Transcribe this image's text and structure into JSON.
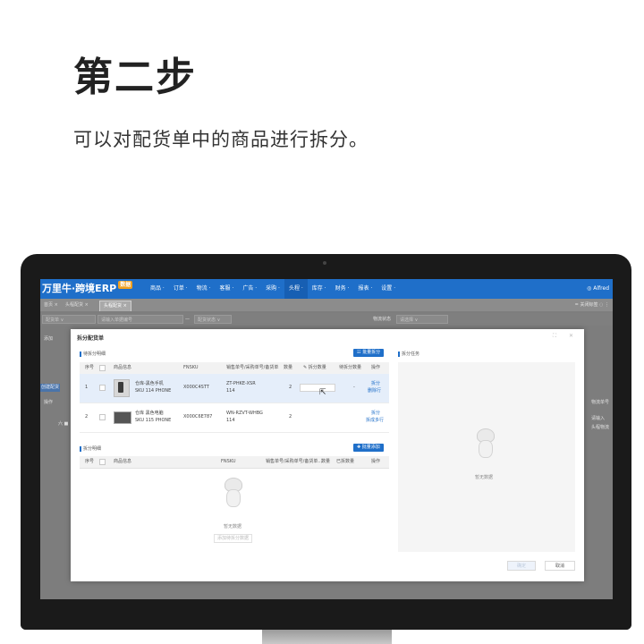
{
  "heading": {
    "title": "第二步",
    "subtitle": "可以对配货单中的商品进行拆分。"
  },
  "app": {
    "brand": "万里牛·跨境ERP",
    "brand_badge": "数据",
    "nav": [
      "商品 ·",
      "订单 ·",
      "物流 ·",
      "客服 ·",
      "广告 ·",
      "采购 ·",
      "头程 ·",
      "库存 ·",
      "财务 ·",
      "报表 ·",
      "设置 ·"
    ],
    "active_nav_index": 6,
    "user": "Alfred",
    "tabs": [
      "首页 ×",
      "头程配货 ×",
      "头程配货 ×"
    ],
    "tab_tools": "= 关闭标签  ◌  ⋮",
    "filters": [
      "配货单 ∨",
      "请输入单据编号",
      "—",
      "配货状态 ∨",
      "物流状态",
      "请选择 ∨"
    ],
    "bg_left": [
      "添加",
      "创建配货",
      "操作",
      "六 ■"
    ],
    "bg_right": [
      "物流单号",
      "请输入",
      "头程物流"
    ]
  },
  "modal": {
    "title": "拆分配货单",
    "controls": "⛶ ✕",
    "source_section": "待拆分明细",
    "batch_split_btn": "☷ 批量拆分",
    "columns": [
      "序号",
      "商品信息",
      "FNSKU",
      "销售单号/采购单号/备货单",
      "数量",
      "✎ 拆分数量",
      "待拆分数量",
      "操作"
    ],
    "rows": [
      {
        "index": "1",
        "name": "仓库-黑色手机",
        "sku": "SKU 114 PHONE",
        "fnsku": "X000C4STT",
        "order": "ZT-PHKE-XSR",
        "order2": "114",
        "qty": "2",
        "remain": "-",
        "op1": "拆分",
        "op2": "删除行"
      },
      {
        "index": "2",
        "name": "仓库 黑色电脑",
        "sku": "SKU 115 PHONE",
        "fnsku": "X000C6E787",
        "order": "WN-RZVT-WHBG",
        "order2": "114",
        "qty": "2",
        "remain": "",
        "op1": "拆分",
        "op2": "拆成多行"
      }
    ],
    "target_section": "拆分明细",
    "batch_add_btn": "✚ 批量添加",
    "columns2": [
      "序号",
      "商品信息",
      "FNSKU",
      "销售单号/采购单号/备货单...",
      "数量",
      "已拆数量",
      "操作"
    ],
    "empty_text": "暂无数据",
    "empty_btn": "添加待拆分数据",
    "right_section": "拆分任务",
    "right_empty": "暂无数据",
    "confirm": "确定",
    "cancel": "取消"
  }
}
